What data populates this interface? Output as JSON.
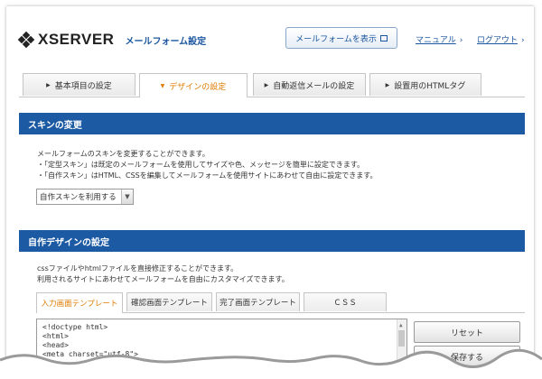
{
  "header": {
    "logo_text": "XSERVER",
    "logo_subtitle": "メールフォーム設定",
    "view_form_button": "メールフォームを表示",
    "manual_link": "マニュアル",
    "logout_link": "ログアウト"
  },
  "tabs": [
    {
      "label": "基本項目の設定",
      "active": false
    },
    {
      "label": "デザインの設定",
      "active": true
    },
    {
      "label": "自動返信メールの設定",
      "active": false
    },
    {
      "label": "設置用のHTMLタグ",
      "active": false
    }
  ],
  "skin_section": {
    "title": "スキンの変更",
    "lines": [
      "メールフォームのスキンを変更することができます。",
      "・「定型スキン」は既定のメールフォームを使用してサイズや色、メッセージを簡単に設定できます。",
      "・「自作スキン」はHTML、CSSを編集してメールフォームを使用サイトにあわせて自由に設定できます。"
    ],
    "select_value": "自作スキンを利用する"
  },
  "custom_section": {
    "title": "自作デザインの設定",
    "lines": [
      "cssファイルやhtmlファイルを直接修正することができます。",
      "利用されるサイトにあわせてメールフォームを自由にカスタマイズできます。"
    ],
    "editor_tabs": [
      {
        "label": "入力画面テンプレート",
        "active": true
      },
      {
        "label": "確認画面テンプレート",
        "active": false
      },
      {
        "label": "完了画面テンプレート",
        "active": false
      },
      {
        "label": "ＣＳＳ",
        "active": false
      }
    ],
    "code_lines": [
      "<!doctype html>",
      "<html>",
      "<head>",
      "<meta charset=\"utf-8\">"
    ],
    "reset_button": "リセット",
    "save_button": "保存する"
  },
  "colors": {
    "accent_blue": "#1d5aa4",
    "link_blue": "#1b56a0",
    "active_tab_orange": "#e07a00"
  }
}
